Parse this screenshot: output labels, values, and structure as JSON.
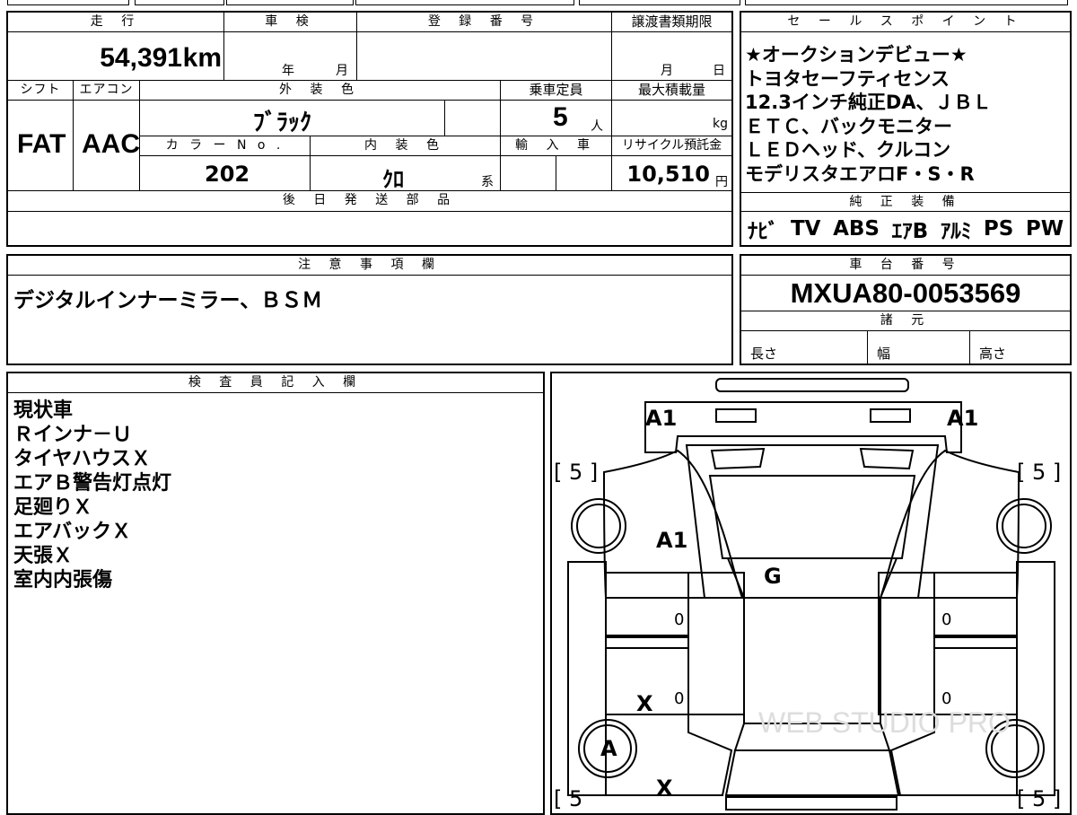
{
  "top_section": {
    "headers": {
      "mileage": "走 行",
      "inspection": "車 検",
      "registration_number": "登 録 番 号",
      "transfer_deadline": "譲渡書類期限",
      "shift": "シフト",
      "aircon": "エアコン",
      "exterior_color": "外 装 色",
      "capacity": "乗車定員",
      "max_load": "最大積載量",
      "color_no": "カ ラ ー N o .",
      "interior_color": "内 装 色",
      "import": "輸 入 車",
      "recycle_fee": "リサイクル預託金",
      "later_parts": "後 日 発 送 部 品"
    },
    "mileage": "54,391",
    "mileage_unit": "km",
    "inspection_year": "年",
    "inspection_month": "月",
    "deadline_month": "月",
    "deadline_day": "日",
    "shift": "FAT",
    "aircon": "AAC",
    "exterior_color": "ﾌﾞﾗｯｸ",
    "capacity": "5",
    "capacity_unit": "人",
    "max_load_unit": "kg",
    "color_no": "202",
    "interior_color": "ｸﾛ",
    "interior_suffix": "系",
    "recycle_fee": "10,510",
    "recycle_unit": "円"
  },
  "sales_points": {
    "header": "セ ー ル ス ポ イ ン ト",
    "lines": [
      "★オークションデビュー★",
      "トヨタセーフティセンス",
      "12.3インチ純正DA、ＪＢＬ",
      "ＥＴＣ、バックモニター",
      "ＬＥＤヘッド、クルコン",
      "モデリスタエアロF・S・R"
    ]
  },
  "genuine_equipment": {
    "header": "純 正 装 備",
    "items": [
      "ﾅﾋﾞ",
      "TV",
      "ABS",
      "ｴｱB",
      "ｱﾙﾐ",
      "PS",
      "PW"
    ]
  },
  "notes": {
    "header": "注 意 事 項 欄",
    "text": "デジタルインナーミラー、ＢＳＭ"
  },
  "chassis": {
    "header": "車 台 番 号",
    "number": "MXUA80-0053569",
    "specs_header": "諸 元",
    "length": "長さ",
    "width": "幅",
    "height": "高さ"
  },
  "inspector": {
    "header": "検 査 員 記 入 欄",
    "lines": [
      "現状車",
      "Ｒインナ－Ｕ",
      "タイヤハウスＸ",
      "エアＢ警告灯点灯",
      "足廻りＸ",
      "エアバックＸ",
      "天張Ｘ",
      "室内内張傷"
    ]
  },
  "diagram": {
    "marks": {
      "front_left": "A1",
      "front_right": "A1",
      "hood": "A1",
      "roof": "G",
      "door_left_front": "0",
      "door_right_front": "0",
      "door_left_rear": "0",
      "door_right_rear": "0",
      "rear_left_x": "X",
      "wheel_rear_left": "A",
      "rear_x": "X"
    },
    "tires": {
      "front_left": "[ 5 ]",
      "front_right": "[ 5 ]",
      "rear_left": "[ 5",
      "rear_right": "[ 5 ]"
    },
    "watermark": "WEB STUDIO PRO"
  }
}
